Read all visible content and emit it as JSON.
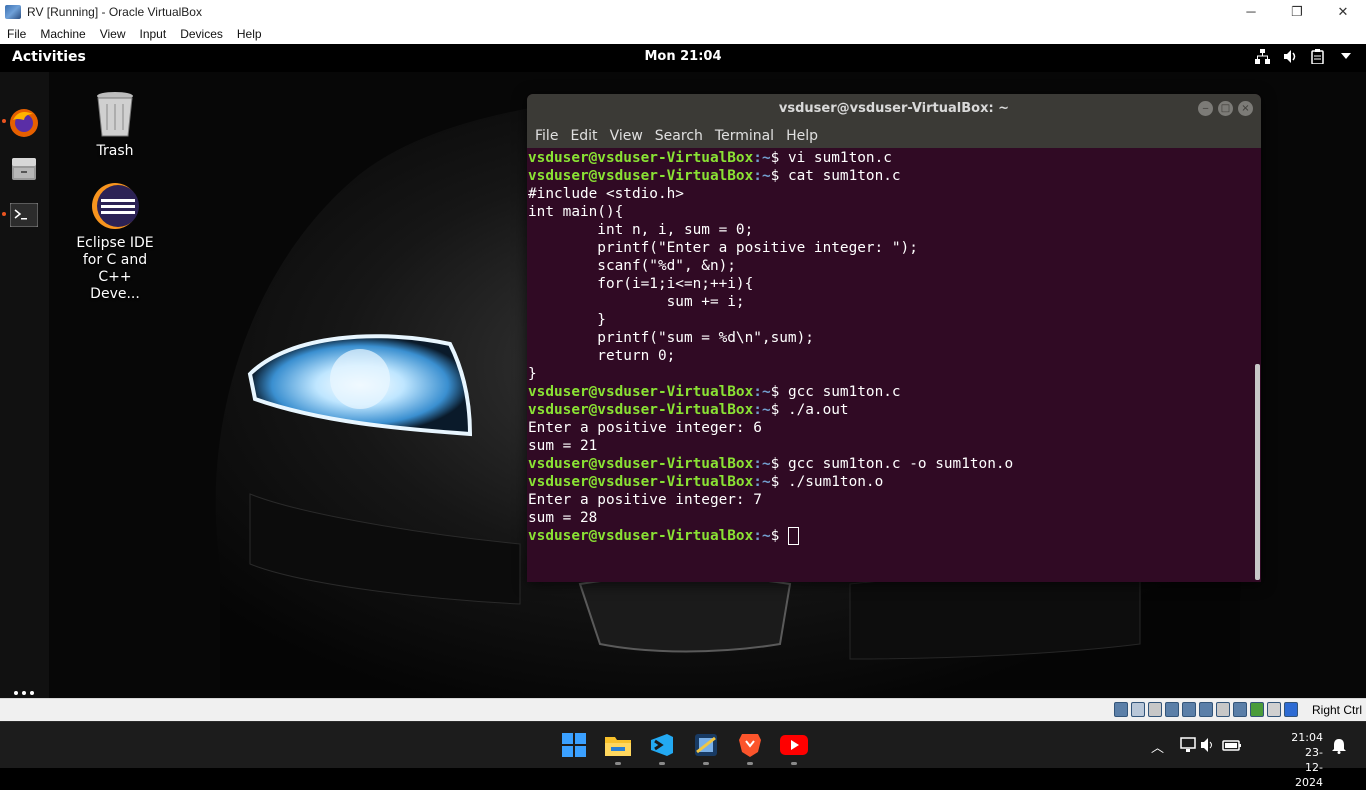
{
  "host_window": {
    "title": "RV [Running] - Oracle VirtualBox",
    "menu": [
      "File",
      "Machine",
      "View",
      "Input",
      "Devices",
      "Help"
    ],
    "controls": {
      "minimize": "─",
      "restore": "❐",
      "close": "✕"
    }
  },
  "guest": {
    "topbar": {
      "activities": "Activities",
      "clock": "Mon 21:04"
    },
    "desktop_icons": [
      {
        "label": "Trash"
      },
      {
        "label": "Eclipse IDE for C and C++ Deve..."
      }
    ],
    "terminal": {
      "title": "vsduser@vsduser-VirtualBox: ~",
      "menu": [
        "File",
        "Edit",
        "View",
        "Search",
        "Terminal",
        "Help"
      ],
      "prompt_user": "vsduser@vsduser-VirtualBox",
      "prompt_sep": ":",
      "prompt_path": "~",
      "prompt_end": "$ ",
      "lines": [
        {
          "type": "cmd",
          "text": "vi sum1ton.c"
        },
        {
          "type": "cmd",
          "text": "cat sum1ton.c"
        },
        {
          "type": "out",
          "text": "#include <stdio.h>"
        },
        {
          "type": "out",
          "text": "int main(){"
        },
        {
          "type": "out",
          "text": "        int n, i, sum = 0;"
        },
        {
          "type": "out",
          "text": "        printf(\"Enter a positive integer: \");"
        },
        {
          "type": "out",
          "text": "        scanf(\"%d\", &n);"
        },
        {
          "type": "out",
          "text": "        for(i=1;i<=n;++i){"
        },
        {
          "type": "out",
          "text": "                sum += i;"
        },
        {
          "type": "out",
          "text": "        }"
        },
        {
          "type": "out",
          "text": "        printf(\"sum = %d\\n\",sum);"
        },
        {
          "type": "out",
          "text": "        return 0;"
        },
        {
          "type": "out",
          "text": "}"
        },
        {
          "type": "cmd",
          "text": "gcc sum1ton.c"
        },
        {
          "type": "cmd",
          "text": "./a.out"
        },
        {
          "type": "out",
          "text": "Enter a positive integer: 6"
        },
        {
          "type": "out",
          "text": "sum = 21"
        },
        {
          "type": "cmd",
          "text": "gcc sum1ton.c -o sum1ton.o"
        },
        {
          "type": "cmd",
          "text": "./sum1ton.o"
        },
        {
          "type": "out",
          "text": "Enter a positive integer: 7"
        },
        {
          "type": "out",
          "text": "sum = 28"
        },
        {
          "type": "cmd",
          "text": "",
          "cursor": true
        }
      ]
    }
  },
  "vbox_status": {
    "host_key": "Right Ctrl"
  },
  "taskbar": {
    "apps": [
      "windows-start-icon",
      "file-explorer-icon",
      "vscode-icon",
      "virtualbox-icon",
      "brave-icon",
      "youtube-icon"
    ],
    "time": "21:04",
    "date": "23-12-2024"
  },
  "colors": {
    "terminal_bg": "#300a24",
    "prompt_user": "#8ae234",
    "prompt_path": "#729fcf",
    "ubuntu_orange": "#e95420"
  }
}
